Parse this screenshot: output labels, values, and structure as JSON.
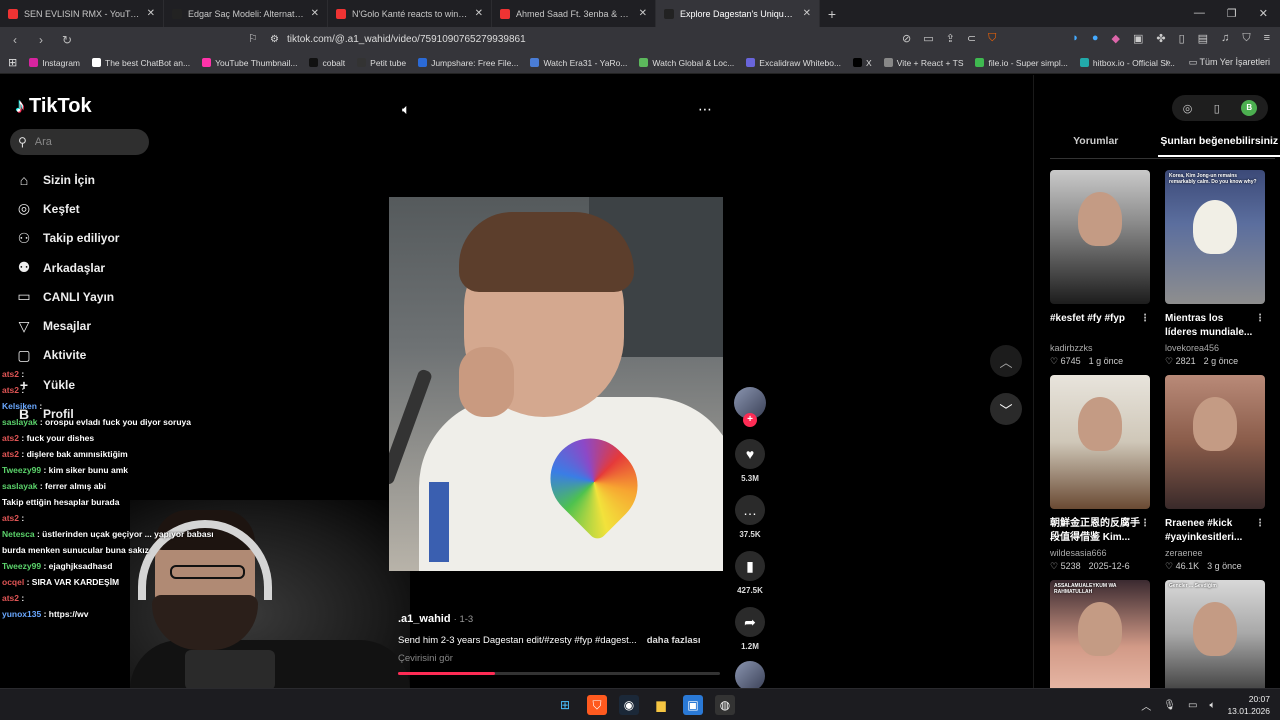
{
  "browser": {
    "tabs": [
      {
        "title": "SEN EVLISIN RMX - YouTube",
        "color": "#e33"
      },
      {
        "title": "Edgar Saç Modeli: Alternatif Stilde Saç",
        "color": "#222"
      },
      {
        "title": "N'Golo Kanté reacts to winning the UEFA",
        "color": "#e33"
      },
      {
        "title": "Ahmed Saad Ft. 3enba & Double Zuksh",
        "color": "#e33"
      },
      {
        "title": "Explore Dagestan's Unique Culture",
        "color": "#222"
      }
    ],
    "url": "tiktok.com/@.a1_wahid/video/7591090765279939861",
    "bookmarks": [
      {
        "label": "Instagram",
        "color": "#d6249f"
      },
      {
        "label": "The best ChatBot an...",
        "color": "#fff"
      },
      {
        "label": "YouTube Thumbnail...",
        "color": "#f3a"
      },
      {
        "label": "cobalt",
        "color": "#111"
      },
      {
        "label": "Petit tube",
        "color": "#333"
      },
      {
        "label": "Jumpshare: Free File...",
        "color": "#2b6ad6"
      },
      {
        "label": "Watch Era31 - YaRo...",
        "color": "#4a7dd6"
      },
      {
        "label": "Watch Global & Loc...",
        "color": "#5cb85c"
      },
      {
        "label": "Excalidraw Whitebo...",
        "color": "#6965db"
      },
      {
        "label": "X",
        "color": "#000"
      },
      {
        "label": "Vite + React + TS",
        "color": "#888"
      },
      {
        "label": "file.io - Super simpl...",
        "color": "#3fb950"
      },
      {
        "label": "hitbox.io - Official Si...",
        "color": "#2aa"
      }
    ],
    "bookmarks_more": "»",
    "all_bookmarks": "Tüm Yer İşaretleri"
  },
  "tiktok": {
    "logo": "TikTok",
    "search_placeholder": "Ara",
    "nav": [
      {
        "label": "Sizin İçin",
        "icon": "⌂",
        "name": "home"
      },
      {
        "label": "Keşfet",
        "icon": "◎",
        "name": "explore"
      },
      {
        "label": "Takip ediliyor",
        "icon": "⚇",
        "name": "following"
      },
      {
        "label": "Arkadaşlar",
        "icon": "⚉",
        "name": "friends"
      },
      {
        "label": "CANLI Yayın",
        "icon": "▭",
        "name": "live"
      },
      {
        "label": "Mesajlar",
        "icon": "▽",
        "name": "messages"
      },
      {
        "label": "Aktivite",
        "icon": "▢",
        "name": "activity"
      },
      {
        "label": "Yükle",
        "icon": "+",
        "name": "upload"
      },
      {
        "label": "Profil",
        "icon": "B",
        "name": "profile"
      }
    ],
    "activity_badge": "2",
    "video": {
      "author": ".a1_wahid",
      "date": "· 1-3",
      "description": "Send him 2-3 years Dagestan edit/#zesty #fyp #dagest...",
      "more": "daha fazlası",
      "translate": "Çevirisini gör",
      "progress": 0.3
    },
    "actions": {
      "likes": "5.3M",
      "comments": "37.5K",
      "saves": "427.5K",
      "shares": "1.2M"
    },
    "right_tabs": [
      "Yorumlar",
      "Şunları beğenebilirsiniz"
    ],
    "profile_initial": "B",
    "recommendations": [
      {
        "title": "#kesfet #fy #fyp",
        "author": "kadirbzzks",
        "likes": "6745",
        "age": "1 g önce",
        "overlay": ""
      },
      {
        "title": "Mientras los líderes mundiale...",
        "author": "lovekorea456",
        "likes": "2821",
        "age": "2 g önce",
        "overlay": "Korea, Kim Jong-un remains remarkably calm. Do you know why?"
      },
      {
        "title": "朝鮮金正恩的反腐手段值得借鉴 Kim...",
        "author": "wildesasia666",
        "likes": "5238",
        "age": "2025-12-6",
        "overlay": ""
      },
      {
        "title": "Rraenee #kick #yayinkesitleri...",
        "author": "zeraenee",
        "likes": "46.1K",
        "age": "3 g önce",
        "overlay": ""
      },
      {
        "title": "",
        "author": "",
        "likes": "",
        "age": "",
        "overlay": "ASSALAMUALEYKUM WA RAHMATULLAH"
      },
      {
        "title": "",
        "author": "",
        "likes": "",
        "age": "",
        "overlay": "Gencler ... Sevdiğim"
      }
    ]
  },
  "chat": [
    {
      "user": "ats2",
      "msg": ":",
      "cls": "u2"
    },
    {
      "user": "ats2",
      "msg": ":",
      "cls": "u2"
    },
    {
      "user": "Kelsiken",
      "msg": ":",
      "cls": "u3"
    },
    {
      "user": "saslayak",
      "msg": ": orospu evladı fuck you diyor soruya",
      "cls": "u"
    },
    {
      "user": "ats2",
      "msg": ": fuck your dishes",
      "cls": "u2"
    },
    {
      "user": "ats2",
      "msg": ": dişlere bak amınısiktiğim",
      "cls": "u2"
    },
    {
      "user": "Tweezy99",
      "msg": ": kim siker bunu amk",
      "cls": "u"
    },
    {
      "user": "saslayak",
      "msg": ": ferrer almış abi",
      "cls": "u"
    },
    {
      "user": "",
      "msg": "Takip ettiğin hesaplar burada",
      "cls": "gm"
    },
    {
      "user": "ats2",
      "msg": ":",
      "cls": "u2"
    },
    {
      "user": "Netesca",
      "msg": ": üstlerinden uçak geçiyor ... yapıyor babası",
      "cls": "u"
    },
    {
      "user": "",
      "msg": "burda menken sunucular buna sakız",
      "cls": "gm"
    },
    {
      "user": "Tweezy99",
      "msg": ": ejaghjksadhasd",
      "cls": "u"
    },
    {
      "user": "ocqel",
      "msg": ": SIRA VAR KARDEŞİM",
      "cls": "u2"
    },
    {
      "user": "ats2",
      "msg": ":",
      "cls": "u2"
    },
    {
      "user": "yunox135",
      "msg": ": https://wv",
      "cls": "u3"
    }
  ],
  "taskbar": {
    "time": "20:07",
    "date": "13.01.2026"
  }
}
